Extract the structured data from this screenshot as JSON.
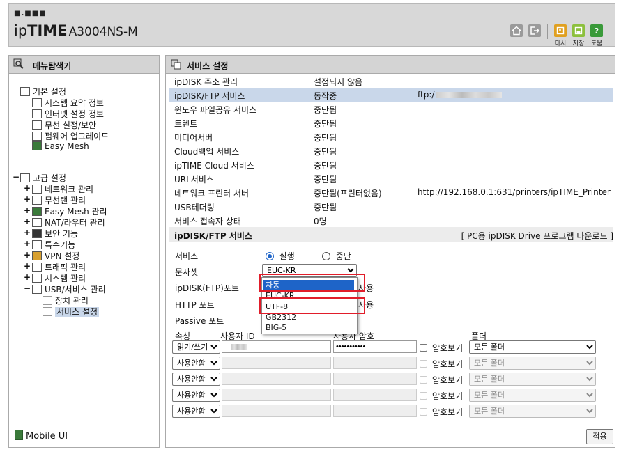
{
  "header": {
    "logo_dots": "■.■■■",
    "logo_ip": "ip",
    "logo_time": "TIME",
    "model": "A3004NS-M",
    "buttons": [
      {
        "icon": "home-icon"
      },
      {
        "icon": "logout-icon"
      },
      {
        "icon": "undo-icon",
        "label": "다시",
        "color": "#e0a020"
      },
      {
        "icon": "save-icon",
        "label": "저장",
        "color": "#8cc03c"
      },
      {
        "icon": "help-icon",
        "label": "도움",
        "color": "#3a9a3a"
      }
    ]
  },
  "sidebar": {
    "title": "메뉴탐색기",
    "basic": {
      "label": "기본 설정",
      "items": [
        "시스템 요약 정보",
        "인터넷 설정 정보",
        "무선 설정/보안",
        "펌웨어 업그레이드",
        "Easy Mesh"
      ]
    },
    "advanced": {
      "expander": "−",
      "label": "고급 설정",
      "items": [
        "네트워크 관리",
        "무선랜 관리",
        "Easy Mesh 관리",
        "NAT/라우터 관리",
        "보안 기능",
        "특수기능",
        "VPN 설정",
        "트래픽 관리",
        "시스템 관리"
      ],
      "usb": {
        "label": "USB/서비스 관리",
        "children": [
          "장치 관리",
          "서비스 설정"
        ]
      }
    },
    "mobile_ui": "Mobile UI",
    "plus": "+",
    "minus": "−"
  },
  "main": {
    "title": "서비스 설정",
    "services": [
      {
        "name": "ipDISK 주소 관리",
        "status": "설정되지 않음",
        "extra": ""
      },
      {
        "name": "ipDISK/FTP 서비스",
        "status": "동작중",
        "extra": "ftp:/"
      },
      {
        "name": "윈도우 파일공유 서비스",
        "status": "중단됨",
        "extra": ""
      },
      {
        "name": "토렌트",
        "status": "중단됨",
        "extra": ""
      },
      {
        "name": "미디어서버",
        "status": "중단됨",
        "extra": ""
      },
      {
        "name": "Cloud백업 서비스",
        "status": "중단됨",
        "extra": ""
      },
      {
        "name": "ipTIME Cloud 서비스",
        "status": "중단됨",
        "extra": ""
      },
      {
        "name": "URL서비스",
        "status": "중단됨",
        "extra": ""
      },
      {
        "name": "네트워크 프린터 서버",
        "status": "중단됨(프린터없음)",
        "extra": "http://192.168.0.1:631/printers/ipTIME_Printer"
      },
      {
        "name": "USB테더링",
        "status": "중단됨",
        "extra": ""
      },
      {
        "name": "서비스 접속자 상태",
        "status": "0명",
        "extra": ""
      }
    ],
    "ftp_section": {
      "title": "ipDISK/FTP 서비스",
      "download_link": "[ PC용 ipDISK Drive 프로그램 다운로드 ]",
      "service_label": "서비스",
      "run_label": "실행",
      "stop_label": "중단",
      "charset_label": "문자셋",
      "charset_value": "EUC-KR",
      "ftp_port_label": "ipDISK(FTP)포트",
      "http_port_label": "HTTP 포트",
      "passive_port_label": "Passive 포트",
      "usage_fragment": "사용",
      "charset_options": [
        "자동",
        "EUC-KR",
        "UTF-8",
        "GB2312",
        "BIG-5"
      ],
      "charset_highlight": "자동"
    },
    "accounts": {
      "headers": {
        "attr": "속성",
        "user_id": "사용자 ID",
        "password": "사용자 암호",
        "folder": "폴더"
      },
      "show_password_label": "암호보기",
      "rows": [
        {
          "attr": "읽기/쓰기",
          "password": "•••••••••••",
          "folder": "모든 폴더",
          "enabled": true
        },
        {
          "attr": "사용안함",
          "password": "",
          "folder": "모든 폴더",
          "enabled": false
        },
        {
          "attr": "사용안함",
          "password": "",
          "folder": "모든 폴더",
          "enabled": false
        },
        {
          "attr": "사용안함",
          "password": "",
          "folder": "모든 폴더",
          "enabled": false
        },
        {
          "attr": "사용안함",
          "password": "",
          "folder": "모든 폴더",
          "enabled": false
        }
      ]
    },
    "apply_label": "적용"
  }
}
